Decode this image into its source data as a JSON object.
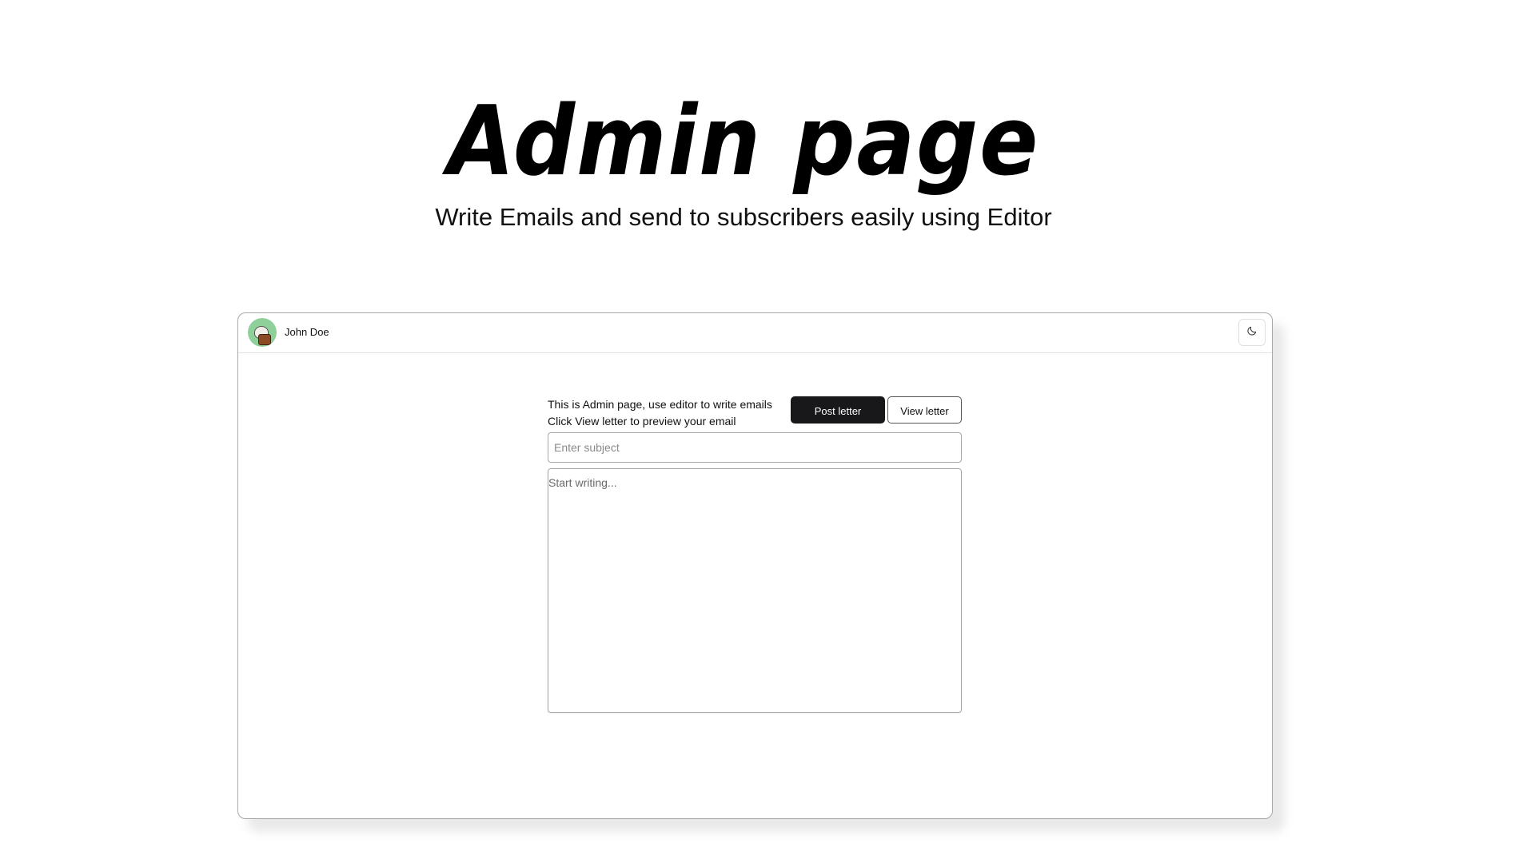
{
  "hero": {
    "title": "Admin page",
    "subtitle": "Write Emails and send to subscribers easily using Editor"
  },
  "topbar": {
    "user_name": "John Doe",
    "avatar_icon": "avatar-icon",
    "theme_toggle_icon": "moon-icon"
  },
  "editor": {
    "info_line1": "This is Admin page, use editor to write emails",
    "info_line2": "Click View letter to preview your email",
    "post_label": "Post letter",
    "view_label": "View letter",
    "subject_placeholder": "Enter subject",
    "subject_value": "",
    "body_placeholder": "Start writing...",
    "body_value": ""
  },
  "colors": {
    "primary_button": "#18181b",
    "avatar_bg": "#8fcf9a"
  }
}
